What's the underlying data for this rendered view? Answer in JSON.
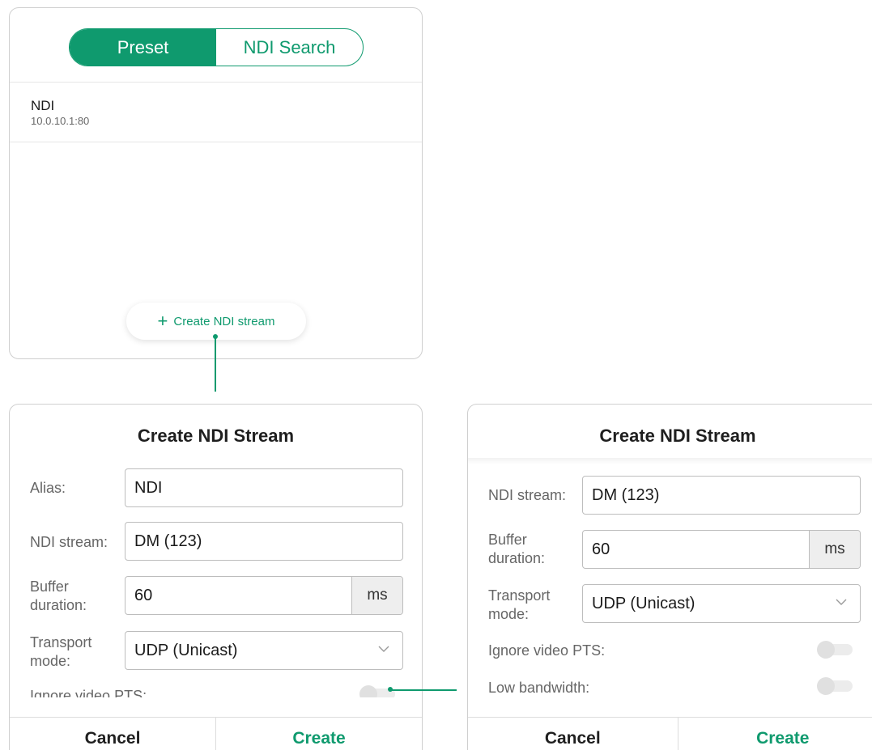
{
  "preset_panel": {
    "tabs": [
      {
        "label": "Preset",
        "active": true
      },
      {
        "label": "NDI Search",
        "active": false
      }
    ],
    "items": [
      {
        "name": "NDI",
        "address": "10.0.10.1:80"
      }
    ],
    "create_button_label": "Create NDI stream",
    "create_icon": "plus-icon"
  },
  "dialog_left": {
    "title": "Create NDI Stream",
    "alias_label": "Alias:",
    "alias_value": "NDI",
    "stream_label": "NDI stream:",
    "stream_value": "DM (123)",
    "buffer_label_line1": "Buffer",
    "buffer_label_line2": "duration:",
    "buffer_value": "60",
    "buffer_unit": "ms",
    "transport_label_line1": "Transport",
    "transport_label_line2": "mode:",
    "transport_value": "UDP (Unicast)",
    "ignore_pts_label": "Ignore video PTS:",
    "cancel_label": "Cancel",
    "create_label": "Create"
  },
  "dialog_right": {
    "title": "Create NDI Stream",
    "stream_label": "NDI stream:",
    "stream_value": "DM (123)",
    "buffer_label_line1": "Buffer",
    "buffer_label_line2": "duration:",
    "buffer_value": "60",
    "buffer_unit": "ms",
    "transport_label_line1": "Transport",
    "transport_label_line2": "mode:",
    "transport_value": "UDP (Unicast)",
    "ignore_pts_label": "Ignore video PTS:",
    "low_bandwidth_label": "Low bandwidth:",
    "cancel_label": "Cancel",
    "create_label": "Create"
  },
  "colors": {
    "accent": "#0f9a6e",
    "label": "#666666",
    "border": "#bdbdbd"
  }
}
